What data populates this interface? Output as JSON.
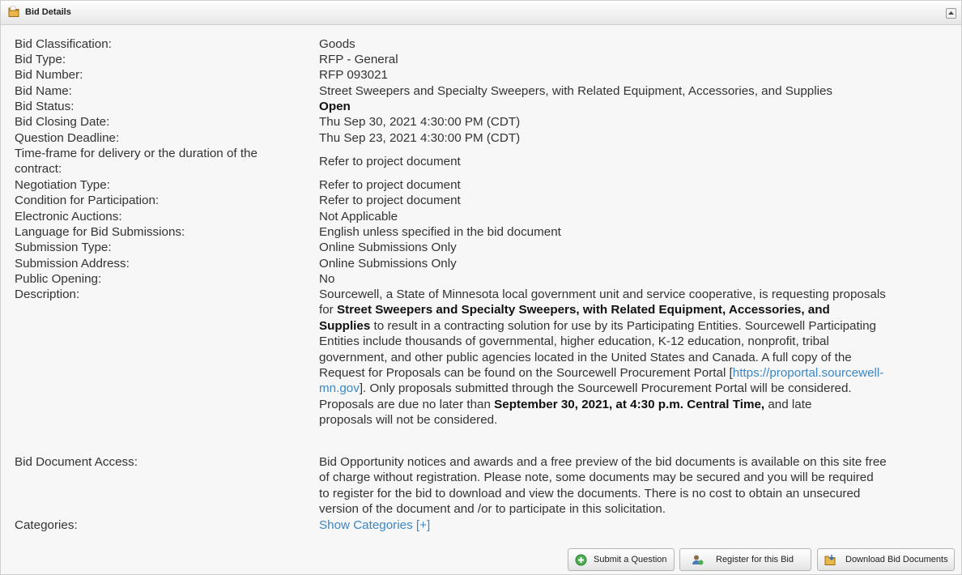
{
  "header": {
    "title": "Bid Details"
  },
  "fields": {
    "classification": {
      "label": "Bid Classification:",
      "value": "Goods"
    },
    "type": {
      "label": "Bid Type:",
      "value": "RFP - General"
    },
    "number": {
      "label": "Bid Number:",
      "value": "RFP 093021"
    },
    "name": {
      "label": "Bid Name:",
      "value": "Street Sweepers and Specialty Sweepers, with Related Equipment, Accessories, and Supplies"
    },
    "status": {
      "label": "Bid Status:",
      "value": "Open"
    },
    "closing": {
      "label": "Bid Closing Date:",
      "value": "Thu Sep 30, 2021 4:30:00 PM (CDT)"
    },
    "question": {
      "label": "Question Deadline:",
      "value": "Thu Sep 23, 2021 4:30:00 PM (CDT)"
    },
    "timeframe": {
      "label_line1": "Time-frame for delivery or the duration of the",
      "label_line2": "contract:",
      "value": "Refer to project document"
    },
    "negotiation": {
      "label": "Negotiation Type:",
      "value": "Refer to project document"
    },
    "condition": {
      "label": "Condition for Participation:",
      "value": "Refer to project document"
    },
    "auctions": {
      "label": "Electronic Auctions:",
      "value": "Not Applicable"
    },
    "language": {
      "label": "Language for Bid Submissions:",
      "value": "English unless specified in the bid document"
    },
    "submission_type": {
      "label": "Submission Type:",
      "value": "Online Submissions Only"
    },
    "submission_address": {
      "label": "Submission Address:",
      "value": "Online Submissions Only"
    },
    "public_opening": {
      "label": "Public Opening:",
      "value": "No"
    },
    "description": {
      "label": "Description:",
      "line1": "Sourcewell, a State of Minnesota local government unit and service cooperative, is requesting proposals",
      "line2_prefix": "for ",
      "line2_bold": "Street Sweepers and Specialty Sweepers, with Related Equipment, Accessories, and",
      "line3_bold": "Supplies",
      "line3_rest": " to result in a contracting solution for use by its Participating Entities.  Sourcewell Participating",
      "line4": "Entities include thousands of governmental, higher education, K-12 education, nonprofit, tribal",
      "line5": "government, and other public agencies located in the United States and Canada. A full copy of the",
      "line6_prefix": "Request for Proposals can be found on the Sourcewell Procurement Portal [",
      "line6_link": "https://proportal.sourcewell-",
      "line7_link": "mn.gov",
      "line7_rest": "]. Only proposals submitted through the Sourcewell Procurement Portal will be considered.",
      "line8_prefix": "Proposals are due no later than ",
      "line8_bold": "September 30, 2021, at 4:30 p.m. Central Time,",
      "line8_rest": " and late",
      "line9": "proposals will not be considered."
    },
    "document_access": {
      "label": "Bid Document Access:",
      "line1": "Bid Opportunity notices and awards and a free preview of the bid documents is available on this site free",
      "line2": "of charge without registration. Please note, some documents may be secured and you will be required",
      "line3": "to register for the bid to download and view the documents. There is no cost to obtain an unsecured",
      "line4": "version of the document and /or to participate in this solicitation."
    },
    "categories": {
      "label": "Categories:",
      "value": "Show Categories [+]"
    }
  },
  "buttons": {
    "submit_question": "Submit a Question",
    "register": "Register for this Bid",
    "download": "Download Bid Documents"
  },
  "icons": {
    "header": "folder-icon",
    "collapse": "chevron-up-icon",
    "submit": "plus-circle-icon",
    "register": "user-icon",
    "download": "folder-download-icon"
  }
}
